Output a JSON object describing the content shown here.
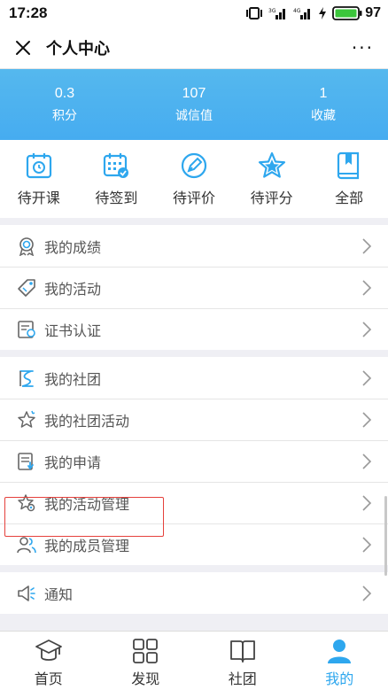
{
  "status_bar": {
    "time": "17:28",
    "battery": "97",
    "net1": "3G",
    "net2": "4G"
  },
  "header": {
    "title": "个人中心",
    "more": "···"
  },
  "stats": [
    {
      "value": "0.3",
      "label": "积分"
    },
    {
      "value": "107",
      "label": "诚信值"
    },
    {
      "value": "1",
      "label": "收藏"
    }
  ],
  "filters": [
    {
      "label": "待开课",
      "icon": "calendar-clock-icon"
    },
    {
      "label": "待签到",
      "icon": "calendar-check-icon"
    },
    {
      "label": "待评价",
      "icon": "pen-circle-icon"
    },
    {
      "label": "待评分",
      "icon": "star-icon"
    },
    {
      "label": "全部",
      "icon": "book-icon"
    }
  ],
  "groups": [
    [
      {
        "label": "我的成绩",
        "icon": "medal-icon"
      },
      {
        "label": "我的活动",
        "icon": "tag-icon"
      },
      {
        "label": "证书认证",
        "icon": "certificate-icon"
      }
    ],
    [
      {
        "label": "我的社团",
        "icon": "club-icon"
      },
      {
        "label": "我的社团活动",
        "icon": "star-outline-icon"
      },
      {
        "label": "我的申请",
        "icon": "application-icon"
      },
      {
        "label": "我的活动管理",
        "icon": "star-gear-icon"
      },
      {
        "label": "我的成员管理",
        "icon": "members-icon"
      }
    ],
    [
      {
        "label": "通知",
        "icon": "speaker-icon"
      }
    ]
  ],
  "bottom_nav": [
    {
      "label": "首页",
      "icon": "graduation-cap-icon",
      "active": false
    },
    {
      "label": "发现",
      "icon": "grid-icon",
      "active": false
    },
    {
      "label": "社团",
      "icon": "open-book-icon",
      "active": false
    },
    {
      "label": "我的",
      "icon": "person-icon",
      "active": true
    }
  ],
  "colors": {
    "accent": "#2ea7ee",
    "banner": "#4fb3ef",
    "highlight": "#e5413c"
  }
}
